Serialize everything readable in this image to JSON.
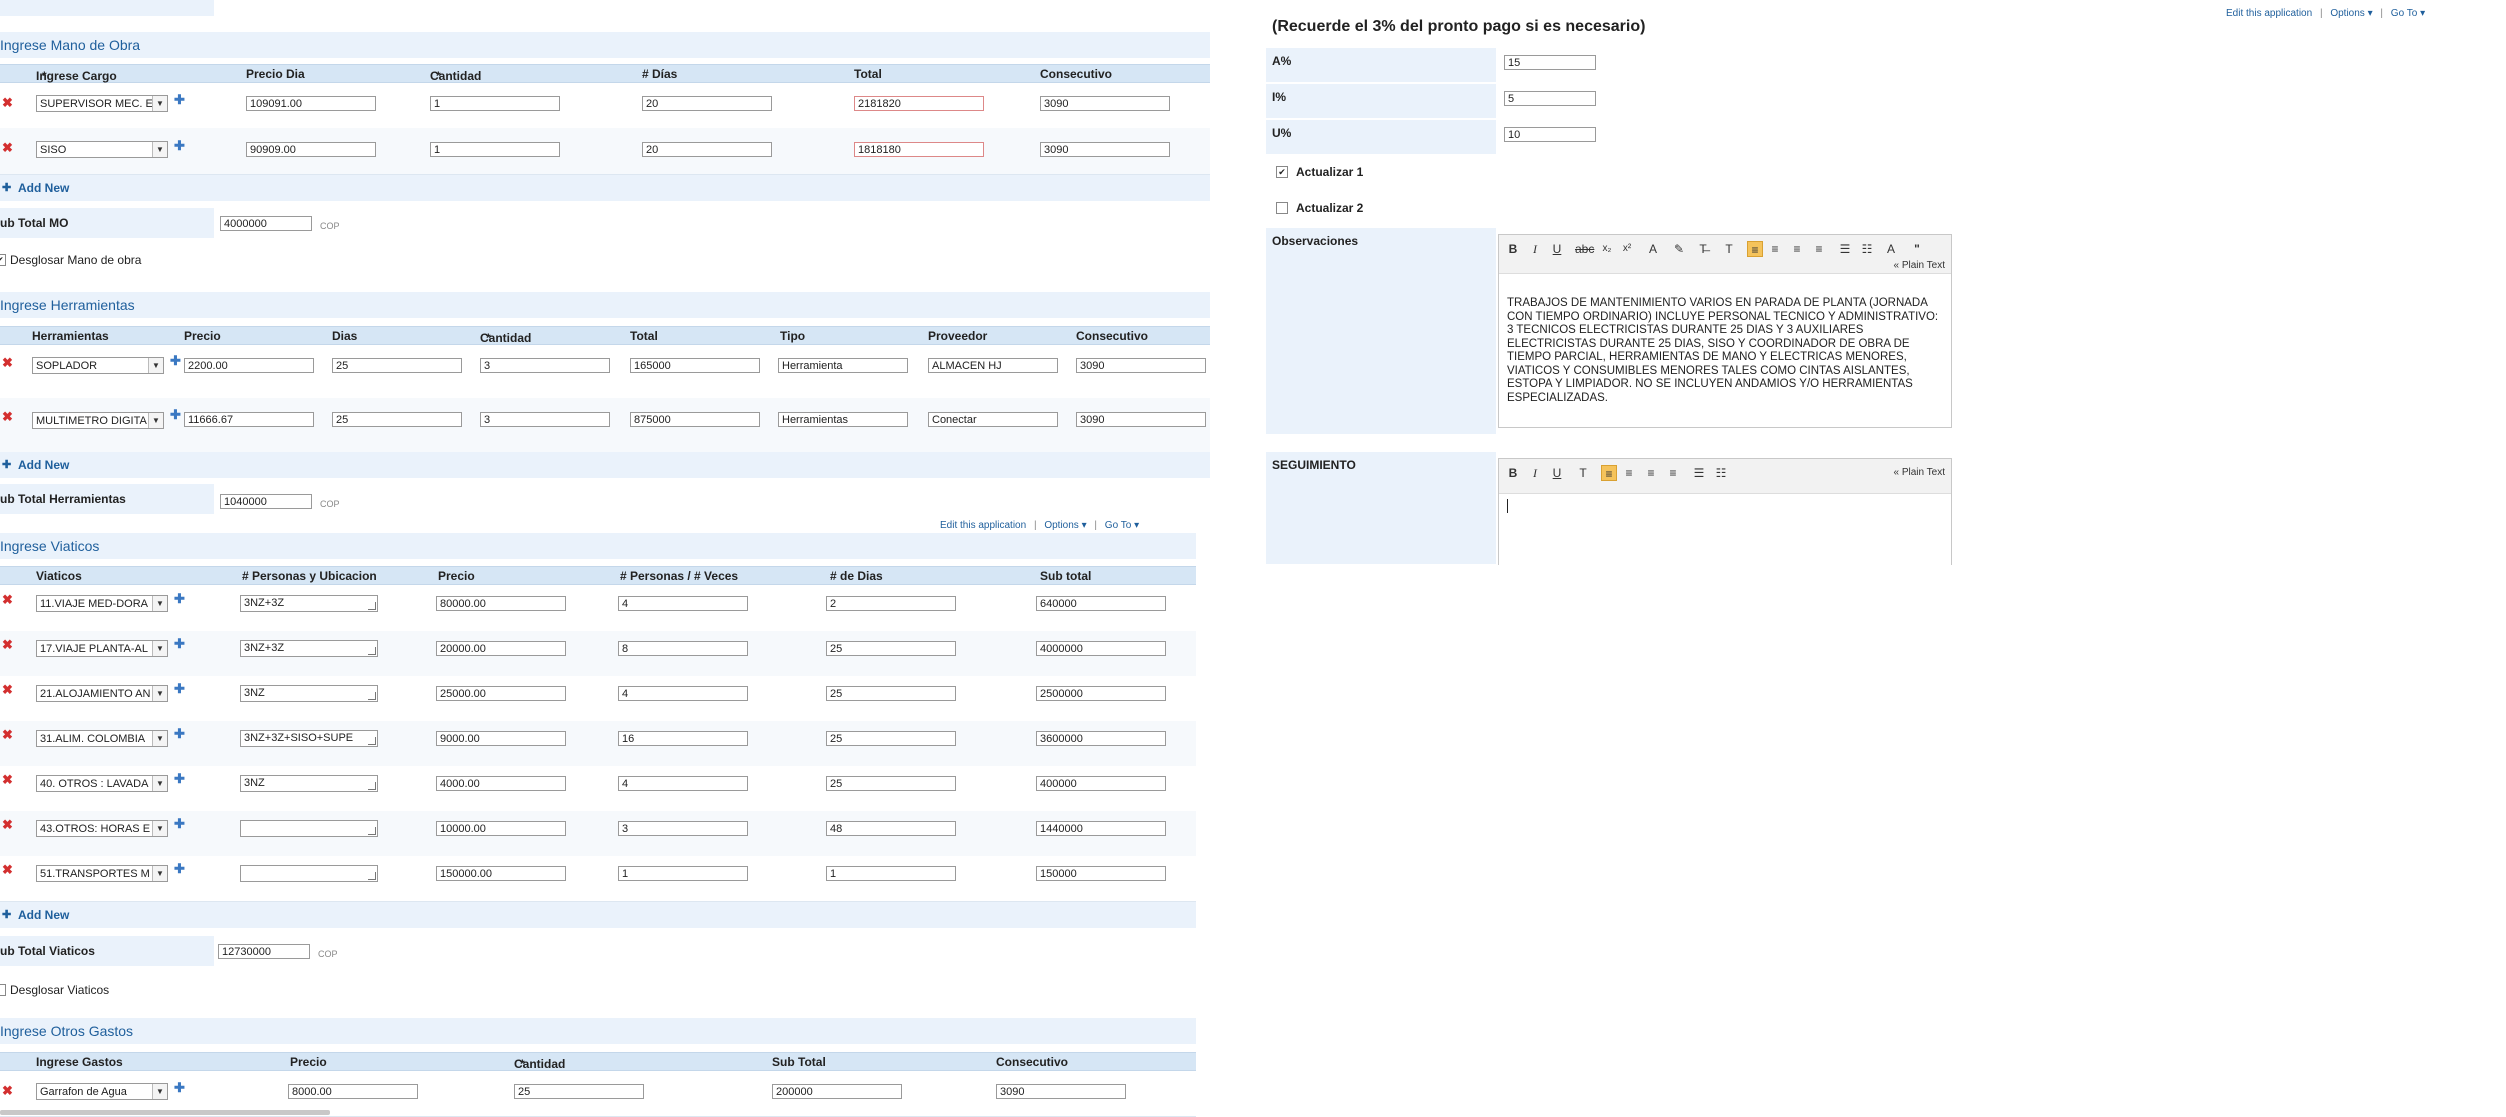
{
  "top_links": {
    "edit_app": "Edit this application",
    "options": "Options",
    "goto": "Go To",
    "sep": "|"
  },
  "mid_links": {
    "edit_app": "Edit this application",
    "options": "Options",
    "goto": "Go To",
    "sep": "|"
  },
  "mano_obra": {
    "title": "Ingrese Mano de Obra",
    "headers": [
      "Ingrese Cargo",
      "Precio Dia",
      "Cantidad",
      "# Días",
      "Total",
      "Consecutivo"
    ],
    "rows": [
      {
        "cargo": "SUPERVISOR MEC. E",
        "precio": "109091.00",
        "cantidad": "1",
        "dias": "20",
        "total": "2181820",
        "consecutivo": "3090"
      },
      {
        "cargo": "SISO",
        "precio": "90909.00",
        "cantidad": "1",
        "dias": "20",
        "total": "1818180",
        "consecutivo": "3090"
      }
    ],
    "add_new": "Add New",
    "subtotal_label": "ub Total MO",
    "subtotal_value": "4000000",
    "currency": "COP",
    "desglosar_label": "Desglosar Mano de obra"
  },
  "herramientas": {
    "title": "Ingrese Herramientas",
    "headers": [
      "Herramientas",
      "Precio",
      "Dias",
      "Cantidad",
      "Total",
      "Tipo",
      "Proveedor",
      "Consecutivo"
    ],
    "rows": [
      {
        "herramienta": "SOPLADOR",
        "precio": "2200.00",
        "dias": "25",
        "cantidad": "3",
        "total": "165000",
        "tipo": "Herramienta",
        "proveedor": "ALMACEN HJ",
        "consecutivo": "3090"
      },
      {
        "herramienta": "MULTIMETRO DIGITA",
        "precio": "11666.67",
        "dias": "25",
        "cantidad": "3",
        "total": "875000",
        "tipo": "Herramientas",
        "proveedor": "Conectar",
        "consecutivo": "3090"
      }
    ],
    "add_new": "Add New",
    "subtotal_label": "ub Total Herramientas",
    "subtotal_value": "1040000",
    "currency": "COP"
  },
  "viaticos": {
    "title": "Ingrese Viaticos",
    "headers": [
      "Viaticos",
      "# Personas y Ubicacion",
      "Precio",
      "# Personas / # Veces",
      "# de Dias",
      "Sub total"
    ],
    "rows": [
      {
        "viatico": "11.VIAJE MED-DORA",
        "personas_ubic": "3NZ+3Z",
        "precio": "80000.00",
        "personas_veces": "4",
        "dias": "2",
        "subtotal": "640000"
      },
      {
        "viatico": "17.VIAJE PLANTA-AL",
        "personas_ubic": "3NZ+3Z",
        "precio": "20000.00",
        "personas_veces": "8",
        "dias": "25",
        "subtotal": "4000000"
      },
      {
        "viatico": "21.ALOJAMIENTO AN",
        "personas_ubic": "3NZ",
        "precio": "25000.00",
        "personas_veces": "4",
        "dias": "25",
        "subtotal": "2500000"
      },
      {
        "viatico": "31.ALIM. COLOMBIA",
        "personas_ubic": "3NZ+3Z+SISO+SUPE",
        "precio": "9000.00",
        "personas_veces": "16",
        "dias": "25",
        "subtotal": "3600000"
      },
      {
        "viatico": "40. OTROS : LAVADA",
        "personas_ubic": "3NZ",
        "precio": "4000.00",
        "personas_veces": "4",
        "dias": "25",
        "subtotal": "400000"
      },
      {
        "viatico": "43.OTROS: HORAS E",
        "personas_ubic": "",
        "precio": "10000.00",
        "personas_veces": "3",
        "dias": "48",
        "subtotal": "1440000"
      },
      {
        "viatico": "51.TRANSPORTES M",
        "personas_ubic": "",
        "precio": "150000.00",
        "personas_veces": "1",
        "dias": "1",
        "subtotal": "150000"
      }
    ],
    "add_new": "Add New",
    "subtotal_label": "ub Total Viaticos",
    "subtotal_value": "12730000",
    "currency": "COP",
    "desglosar_label": "Desglosar Viaticos"
  },
  "otros_gastos": {
    "title": "Ingrese Otros Gastos",
    "headers": [
      "Ingrese Gastos",
      "Precio",
      "Cantidad",
      "Sub Total",
      "Consecutivo"
    ],
    "rows": [
      {
        "gasto": "Garrafon de Agua",
        "precio": "8000.00",
        "cantidad": "25",
        "subtotal": "200000",
        "consecutivo": "3090"
      }
    ]
  },
  "right_panel": {
    "notice": "(Recuerde el 3% del pronto pago si es necesario)",
    "a_label": "A%",
    "a_value": "15",
    "i_label": "I%",
    "i_value": "5",
    "u_label": "U%",
    "u_value": "10",
    "actualizar1_label": "Actualizar 1",
    "actualizar2_label": "Actualizar 2",
    "observaciones_label": "Observaciones",
    "observaciones_text": "TRABAJOS DE MANTENIMIENTO VARIOS EN PARADA DE PLANTA (JORNADA CON TIEMPO ORDINARIO) INCLUYE PERSONAL TECNICO Y ADMINISTRATIVO: 3 TECNICOS ELECTRICISTAS DURANTE 25 DIAS Y 3 AUXILIARES ELECTRICISTAS DURANTE 25 DIAS, SISO Y COORDINADOR  DE OBRA DE TIEMPO PARCIAL, HERRAMIENTAS DE MANO Y ELECTRICAS MENORES, VIATICOS Y CONSUMIBLES MENORES TALES COMO CINTAS AISLANTES, ESTOPA Y LIMPIADOR. NO SE INCLUYEN ANDAMIOS Y/O HERRAMIENTAS ESPECIALIZADAS.",
    "seguimiento_label": "SEGUIMIENTO",
    "plain_text": "« Plain Text",
    "seguimiento_text": ""
  }
}
